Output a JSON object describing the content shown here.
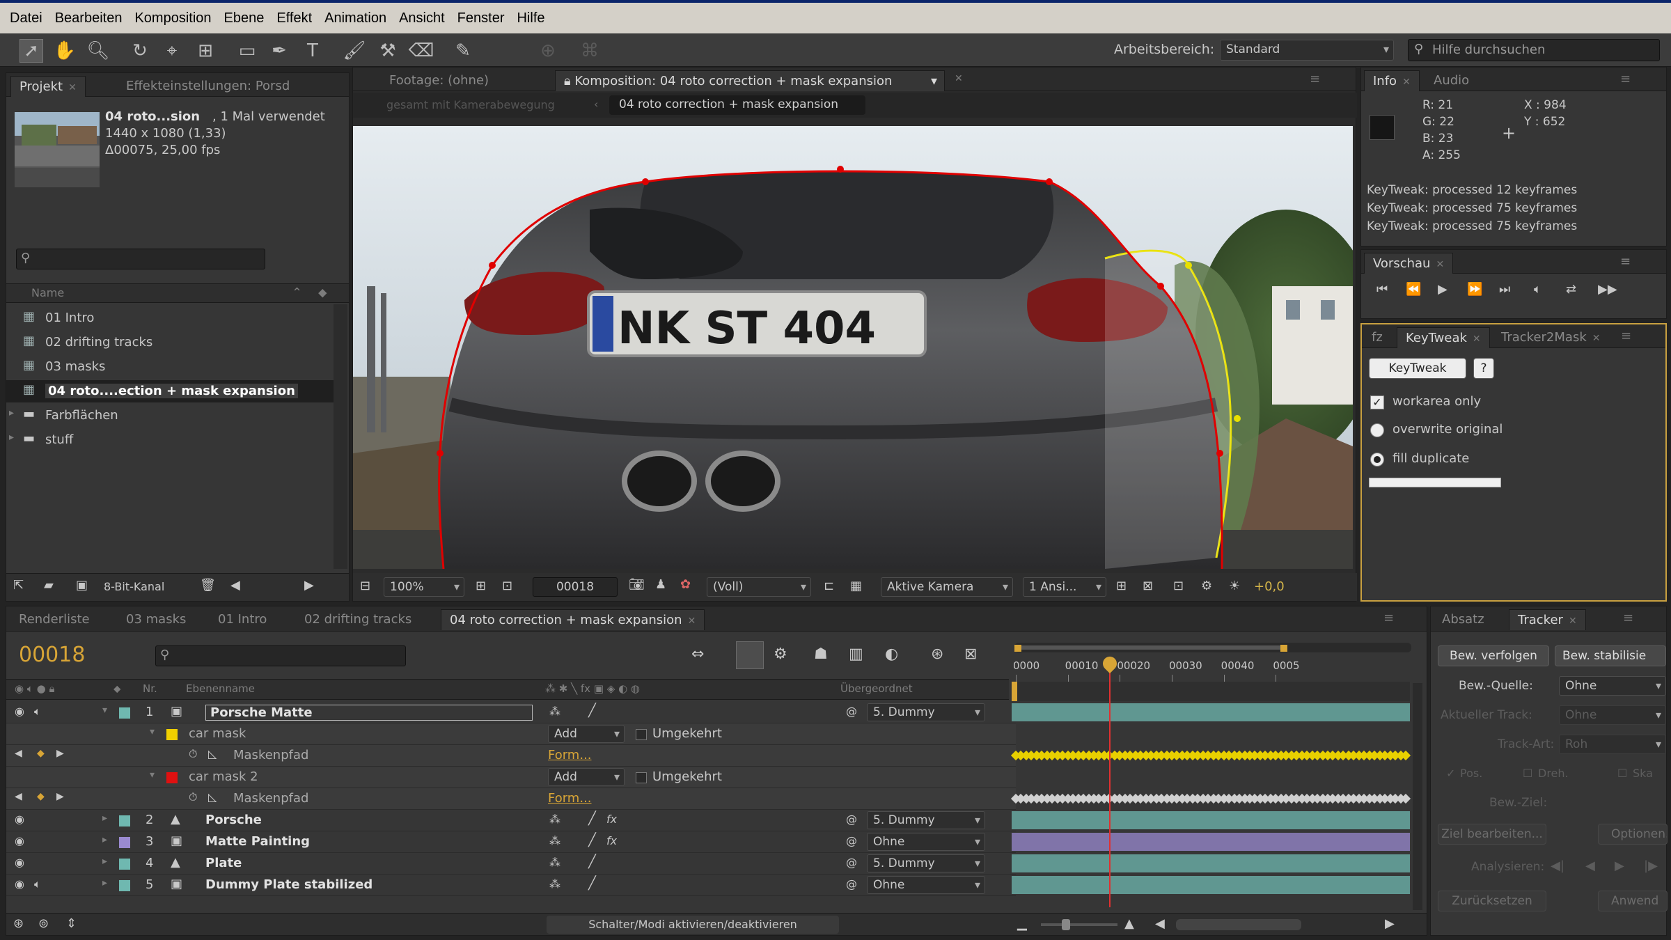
{
  "menu": [
    "Datei",
    "Bearbeiten",
    "Komposition",
    "Ebene",
    "Effekt",
    "Animation",
    "Ansicht",
    "Fenster",
    "Hilfe"
  ],
  "toolbar": {
    "workspace_label": "Arbeitsbereich:",
    "workspace_value": "Standard",
    "help_placeholder": "Hilfe durchsuchen"
  },
  "project": {
    "tabs": [
      "Projekt",
      "Effekteinstellungen: Porsd"
    ],
    "item_name": "04 roto...sion",
    "item_usage": ", 1 Mal verwendet",
    "item_res": "1440 x 1080 (1,33)",
    "item_dur": "Δ00075, 25,00 fps",
    "col_name": "Name",
    "items": [
      {
        "label": "01 Intro",
        "type": "comp"
      },
      {
        "label": "02 drifting tracks",
        "type": "comp"
      },
      {
        "label": "03 masks",
        "type": "comp"
      },
      {
        "label": "04 roto....ection + mask expansion",
        "type": "comp",
        "selected": true
      },
      {
        "label": "Farbflächen",
        "type": "folder"
      },
      {
        "label": "stuff",
        "type": "folder"
      }
    ],
    "bit_depth": "8-Bit-Kanal"
  },
  "viewer": {
    "tabs": [
      "Footage: (ohne)",
      "Komposition: 04 roto correction + mask expansion"
    ],
    "subtab_dim": "gesamt mit Kamerabewegung",
    "subtab_active": "04 roto correction + mask expansion",
    "plate": "NK ST 404",
    "zoom": "100%",
    "timecode": "00018",
    "resolution": "(Voll)",
    "camera": "Aktive Kamera",
    "views": "1 Ansi...",
    "exposure": "+0,0"
  },
  "info": {
    "tabs": [
      "Info",
      "Audio"
    ],
    "r": "R:  21",
    "g": "G:  22",
    "b": "B:  23",
    "a": "A:  255",
    "x": "X : 984",
    "y": "Y : 652",
    "log": [
      "KeyTweak: processed 12 keyframes",
      "KeyTweak: processed 75 keyframes",
      "KeyTweak: processed 75 keyframes"
    ],
    "swatch_color": "#161616"
  },
  "preview": {
    "tab": "Vorschau"
  },
  "keytweak": {
    "tabs": [
      "fz",
      "KeyTweak",
      "Tracker2Mask"
    ],
    "button": "KeyTweak",
    "help": "?",
    "opt1": "workarea only",
    "opt2": "overwrite original",
    "opt3": "fill duplicate"
  },
  "timeline": {
    "tabs": [
      "Renderliste",
      "03 masks",
      "01 Intro",
      "02 drifting tracks",
      "04 roto correction + mask expansion"
    ],
    "current_time": "00018",
    "col_nr": "Nr.",
    "col_name": "Ebenenname",
    "col_parent": "Übergeordnet",
    "ruler": [
      "0000",
      "00010",
      "00020",
      "00030",
      "00040",
      "0005"
    ],
    "layers": [
      {
        "nr": "1",
        "name": "Porsche Matte",
        "parent": "5. Dummy",
        "color": "#6fb8b0",
        "type": "layer",
        "editing": true
      },
      {
        "name": "car mask",
        "mode": "Add",
        "inverted": "Umgekehrt",
        "color": "#f0d000",
        "type": "mask"
      },
      {
        "name": "Maskenpfad",
        "value": "Form...",
        "type": "prop",
        "kfcolor": "#e8d000"
      },
      {
        "name": "car mask 2",
        "mode": "Add",
        "inverted": "Umgekehrt",
        "color": "#e01010",
        "type": "mask"
      },
      {
        "name": "Maskenpfad",
        "value": "Form...",
        "type": "prop",
        "kfcolor": "#d0d0d0"
      },
      {
        "nr": "2",
        "name": "Porsche",
        "parent": "5. Dummy",
        "color": "#6fb8b0",
        "type": "layer"
      },
      {
        "nr": "3",
        "name": "Matte Painting",
        "parent": "Ohne",
        "color": "#9a8ad0",
        "type": "layer"
      },
      {
        "nr": "4",
        "name": "Plate",
        "parent": "5. Dummy",
        "color": "#6fb8b0",
        "type": "layer"
      },
      {
        "nr": "5",
        "name": "Dummy Plate stabilized",
        "parent": "Ohne",
        "color": "#6fb8b0",
        "type": "layer"
      }
    ],
    "switch_label": "Schalter/Modi aktivieren/deaktivieren",
    "playhead_frame": 18,
    "frames_total": 75
  },
  "tracker": {
    "tabs": [
      "Absatz",
      "Tracker"
    ],
    "btn_track": "Bew. verfolgen",
    "btn_stab": "Bew. stabilisie",
    "source_label": "Bew.-Quelle:",
    "source_value": "Ohne",
    "current_track": "Aktueller Track:",
    "current_track_val": "Ohne",
    "track_type": "Track-Art:",
    "track_type_val": "Roh",
    "pos": "Pos.",
    "rot": "Dreh.",
    "scale": "Ska",
    "target": "Bew.-Ziel:",
    "edit_target": "Ziel bearbeiten...",
    "options": "Optionen...",
    "analyze": "Analysieren:",
    "reset": "Zurücksetzen",
    "apply": "Anwend"
  }
}
